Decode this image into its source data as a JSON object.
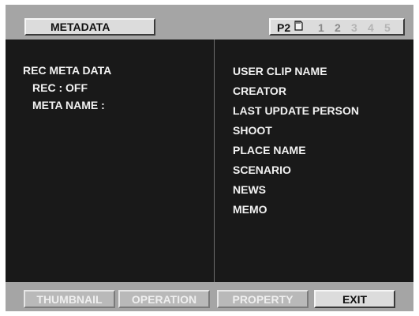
{
  "header": {
    "title": "METADATA",
    "card_label": "P2",
    "slots": [
      {
        "label": "1",
        "color": "#8a8a8a"
      },
      {
        "label": "2",
        "color": "#8a8a8a"
      },
      {
        "label": "3",
        "color": "#b4b4b4"
      },
      {
        "label": "4",
        "color": "#b4b4b4"
      },
      {
        "label": "5",
        "color": "#b4b4b4"
      }
    ]
  },
  "left": {
    "heading": "REC META DATA",
    "rec": "REC : OFF",
    "meta_name": "META NAME :"
  },
  "right": {
    "items": [
      "USER CLIP NAME",
      "CREATOR",
      "LAST UPDATE PERSON",
      "SHOOT",
      "PLACE NAME",
      "SCENARIO",
      "NEWS",
      "MEMO"
    ]
  },
  "footer": {
    "buttons": [
      {
        "label": "THUMBNAIL",
        "enabled": false
      },
      {
        "label": "OPERATION",
        "enabled": false
      },
      {
        "label": "PROPERTY",
        "enabled": false
      },
      {
        "label": "EXIT",
        "enabled": true
      }
    ]
  },
  "colors": {
    "panel_bg": "#191919",
    "bar_bg": "#a5a5a5",
    "button_bg": "#dcdcdc",
    "text_light": "#f2f2f2"
  }
}
